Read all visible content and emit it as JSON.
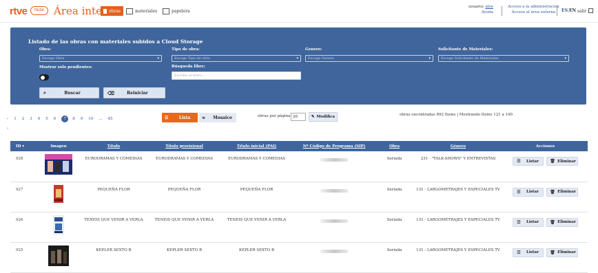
{
  "header": {
    "brand": "rtve",
    "brand_sub": "Nube",
    "area": "Área interna",
    "nav": [
      {
        "label": "obras",
        "icon": "film-icon",
        "active": true
      },
      {
        "label": "materiales",
        "icon": "film-strip-icon"
      },
      {
        "label": "papelera",
        "icon": "trash-icon"
      }
    ],
    "user_prefix": "usuario:",
    "user_name": "alee",
    "help": "Ayuda",
    "admin_link": "Acceso a la administración",
    "external_link": "Acceso al área externa",
    "lang_es": "ES",
    "lang_en": "EN",
    "lang_sep": "|",
    "logout": "salir"
  },
  "filters": {
    "title": "Listado de las obras con materiales subidos a Cloud Storage",
    "obra_label": "Obra:",
    "obra_placeholder": "Escoge Obra",
    "tipo_label": "Tipo de obra:",
    "tipo_placeholder": "Escoge Tipo de obra",
    "genero_label": "Genero:",
    "genero_placeholder": "Escoge Genero",
    "solicitante_label": "Solicitante de Materiales:",
    "solicitante_placeholder": "Escoge Solicitante de Materiales",
    "pendientes_label": "Mostrar solo pendientes:",
    "busqueda_label": "Búsqueda libre:",
    "busqueda_placeholder": "Escribe el texto...",
    "buscar": "Buscar",
    "reiniciar": "Reiniciar"
  },
  "pagination": {
    "pages": [
      "1",
      "2",
      "3",
      "4",
      "5",
      "6",
      "7",
      "8",
      "9",
      "10",
      "...",
      "45"
    ],
    "current": "7",
    "prev": "‹",
    "next": "›"
  },
  "view": {
    "lista": "Lista",
    "mosaico": "Mosaico",
    "per_page_label": "obras por página:",
    "per_page_value": "20",
    "modifica": "Modifica",
    "found_text": "obras encontradas 892 Items | Mostrando Items 121 a 140"
  },
  "table": {
    "headers": [
      "ID",
      "Imagen",
      "Título",
      "Título provisional",
      "Título inicial (PAI)",
      "Nº Código de Programa (SIP)",
      "Obra",
      "Género",
      "Acciones"
    ],
    "listar": "Listar",
    "eliminar": "Eliminar",
    "rows": [
      {
        "id": "928",
        "titulo": "EURODRAMAS Y COMEDIAS",
        "provisional": "EURODRAMAS Y COMEDIAS",
        "inicial": "EURODRAMAS Y COMEDIAS",
        "obra": "Seriada",
        "genero": "231 - \"TALK-SHOWS\" Y ENTREVISTAS"
      },
      {
        "id": "927",
        "titulo": "PEQUEÑA FLOR",
        "provisional": "PEQUEÑA FLOR",
        "inicial": "PEQUEÑA FLOR",
        "obra": "Seriada",
        "genero": "131 - LARGOMETRAJES Y ESPECIALES TV"
      },
      {
        "id": "926",
        "titulo": "TENEIS QUE VENIR A VERLA",
        "provisional": "TENEIS QUE VENIR A VERLA",
        "inicial": "TENEIS QUE VENIR A VERLA",
        "obra": "Seriada",
        "genero": "131 - LARGOMETRAJES Y ESPECIALES TV"
      },
      {
        "id": "925",
        "titulo": "KEPLER SEXTO B",
        "provisional": "KEPLER SEXTO B",
        "inicial": "KEPLER SEXTO B",
        "obra": "Seriada",
        "genero": "131 - LARGOMETRAJES Y ESPECIALES TV"
      }
    ]
  },
  "colors": {
    "brand": "#e3601d",
    "panel": "#3f659c",
    "accent": "#e8681b"
  }
}
